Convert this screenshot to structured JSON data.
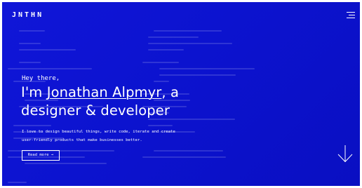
{
  "header": {
    "logo": "JNTHN",
    "menu_icon": "hamburger-menu-icon"
  },
  "hero": {
    "greeting": "Hey there,",
    "headline_prefix": "I'm ",
    "name": "Jonathan Alpmyr",
    "headline_suffix": ", a",
    "headline_line2": "designer & developer",
    "description_line1": "I love to design beautiful things, write code, iterate and create",
    "description_line2": "user-friendly products that make businesses better.",
    "read_more_label": "Read more →",
    "scroll_icon": "arrow-down-icon"
  },
  "colors": {
    "background": "#0c13cf",
    "text": "#ffffff"
  }
}
